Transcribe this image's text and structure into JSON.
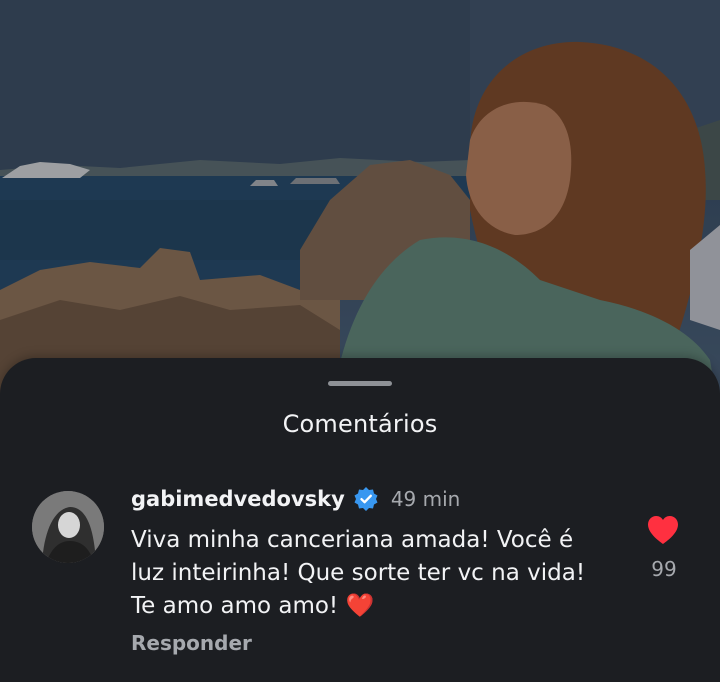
{
  "sheet": {
    "title": "Comentários"
  },
  "comment": {
    "username": "gabimedvedovsky",
    "verified": true,
    "timestamp": "49 min",
    "text": "Viva minha canceriana amada! Você é luz inteirinha! Que sorte ter vc na vida! Te amo amo amo! ❤️",
    "reply_label": "Responder",
    "like_count": "99",
    "liked": true
  },
  "colors": {
    "sheet_background": "#1c1e22",
    "like_heart": "#ff3040",
    "verified_badge": "#3897f0",
    "primary_text": "#f2f3f5",
    "secondary_text": "#a6a9ae"
  },
  "icons": {
    "verified": "verified-badge-icon",
    "like": "heart-filled-icon"
  }
}
